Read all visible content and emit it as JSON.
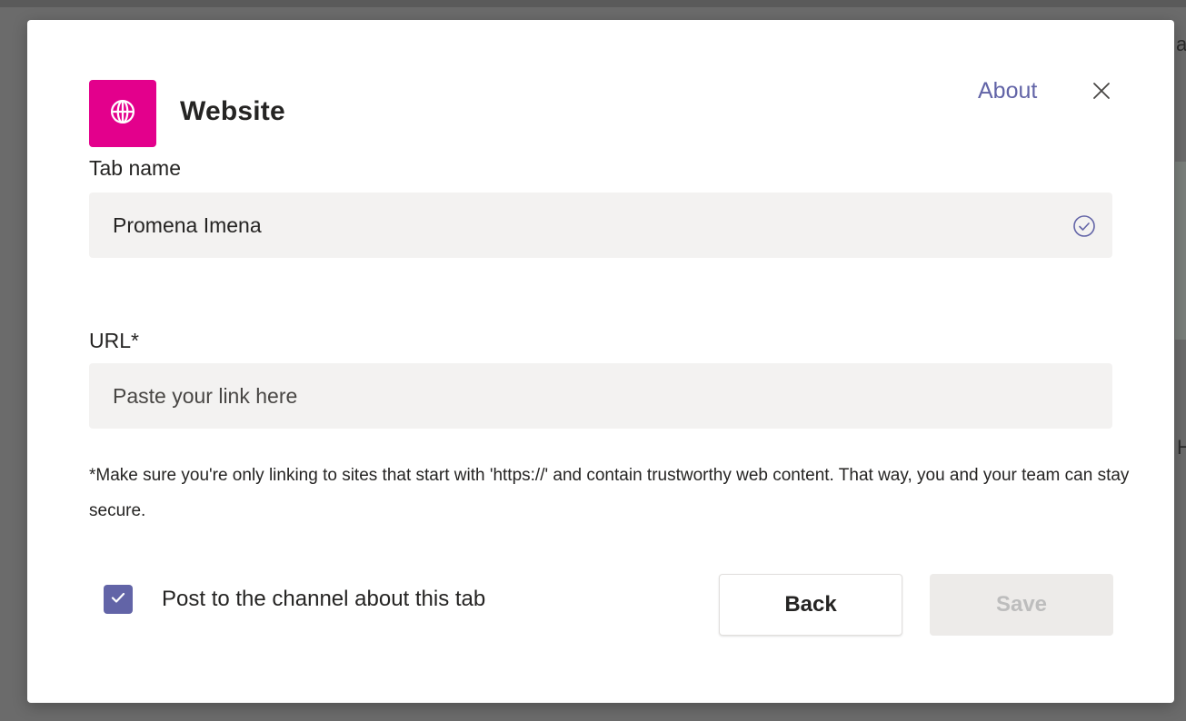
{
  "background": {
    "edge_letter_top": "a",
    "edge_letter_bottom": "H"
  },
  "dialog": {
    "app_icon": "globe-icon",
    "app_color": "#e3008c",
    "title": "Website",
    "about_label": "About",
    "close_icon": "close-icon"
  },
  "form": {
    "tab_name": {
      "label": "Tab name",
      "value": "Promena Imena",
      "status_icon": "check-circle-icon"
    },
    "url": {
      "label": "URL*",
      "value": "",
      "placeholder": "Paste your link here"
    },
    "hint": "*Make sure you're only linking to sites that start with 'https://' and contain trustworthy web content. That way, you and your team can stay secure.",
    "post_to_channel": {
      "checked": true,
      "label": "Post to the channel about this tab"
    }
  },
  "buttons": {
    "back_label": "Back",
    "save_label": "Save"
  },
  "colors": {
    "accent": "#6264a7",
    "disabled_text": "#bdbdbd"
  }
}
